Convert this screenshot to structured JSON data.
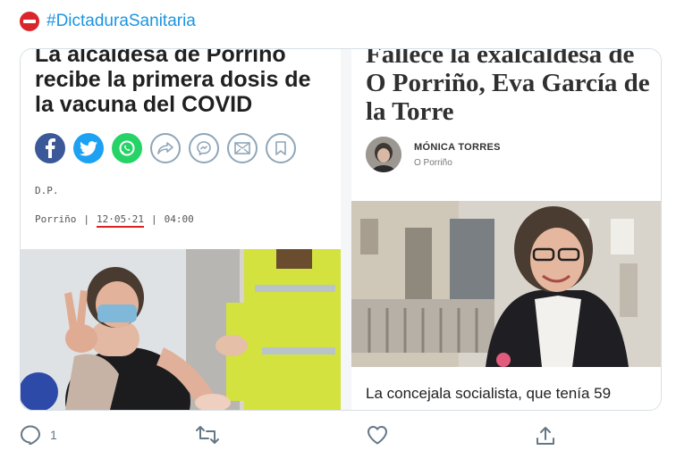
{
  "tweet": {
    "hashtag": "#DictaduraSanitaria"
  },
  "left_article": {
    "headline": "La alcaldesa de Porriño recibe la primera dosis de la vacuna del COVID",
    "byline": "D.P.",
    "location": "Porriño",
    "sep1": "|",
    "date": "12·05·21",
    "sep2": "|",
    "time": "04:00"
  },
  "right_article": {
    "headline": "Fallece la exalcaldesa de O Porriño, Eva García de la Torre",
    "author_name": "MÓNICA TORRES",
    "author_location": "O Porriño",
    "snippet": "La concejala socialista, que tenía 59"
  },
  "actions": {
    "reply_count": "1"
  },
  "colors": {
    "hashtag": "#1b95e0",
    "facebook": "#3b5998",
    "twitter": "#1da1f2",
    "whatsapp": "#25d366",
    "date_underline": "#e02020",
    "action_icons": "#657786"
  },
  "icons": [
    "no-entry-icon",
    "facebook-icon",
    "twitter-icon",
    "whatsapp-icon",
    "share-icon",
    "messenger-icon",
    "email-icon",
    "bookmark-icon",
    "reply-icon",
    "retweet-icon",
    "like-icon",
    "share-tweet-icon"
  ]
}
